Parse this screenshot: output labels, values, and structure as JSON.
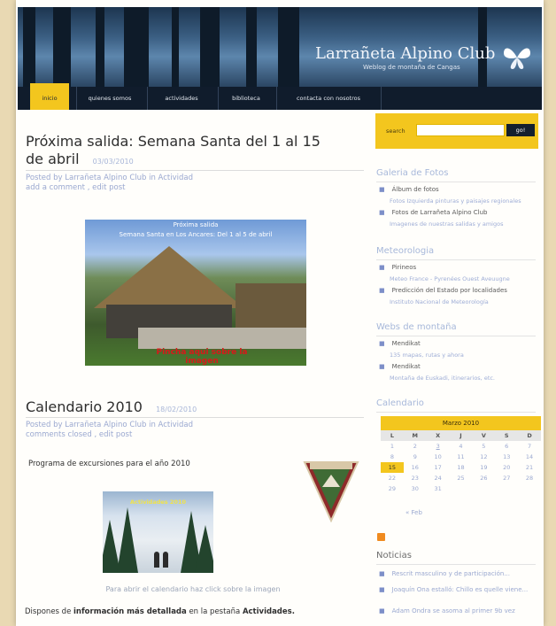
{
  "header": {
    "site_title": "Larrañeta Alpino Club",
    "site_subtitle": "Weblog de montaña de Cangas"
  },
  "nav": {
    "items": [
      {
        "label": "inicio",
        "active": true
      },
      {
        "label": "quienes somos"
      },
      {
        "label": "actividades"
      },
      {
        "label": "biblioteca"
      },
      {
        "label": "contacta con nosotros"
      }
    ]
  },
  "posts": [
    {
      "title_line1": "Próxima salida: Semana Santa del 1 al 15",
      "title_line2": "de abril",
      "date": "03/03/2010",
      "meta_line1": "Posted by Larrañeta Alpino Club in Actividad",
      "meta_line2": "add a comment , edit post",
      "image_caption_line1": "Próxima salida",
      "image_caption_line2": "Semana Santa en Los Ancares: Del 1 al 5 de abril",
      "image_red_text": "Pincha aqui sobre la imagen"
    },
    {
      "title": "Calendario 2010",
      "date": "18/02/2010",
      "meta_line1": "Posted by Larrañeta Alpino Club in Actividad",
      "meta_line2": "comments closed , edit post",
      "intro": "Programa de excursiones para el año 2010",
      "photo_caption": "Actividades 2010",
      "click_caption": "Para abrir el calendario haz click sobre la imagen",
      "bottom_plain": "Dispones de ",
      "bottom_bold": "información más detallada",
      "bottom_plain2": " en la  pestaña ",
      "bottom_bold2": "Actividades."
    }
  ],
  "sidebar": {
    "search_label": "search",
    "search_value": "",
    "search_button": "go!",
    "sections": [
      {
        "heading": "Galeria de Fotos",
        "items": [
          {
            "label": "Álbum de fotos",
            "sub": "Fotos Izquierda pinturas y paisajes regionales"
          },
          {
            "label": "Fotos de Larrañeta Alpino Club",
            "sub": "Imagenes de nuestras salidas y amigos"
          }
        ]
      },
      {
        "heading": "Meteorologia",
        "items": [
          {
            "label": "Pirineos",
            "sub": "Meteo France - Pyrenées Ouest Aveuugne"
          },
          {
            "label": "Predicción del Estado por localidades",
            "sub": "Instituto Nacional de Meteorología"
          }
        ]
      },
      {
        "heading": "Webs de montaña",
        "items": [
          {
            "label": "Mendikat",
            "sub": "135 mapas, rutas y ahora"
          },
          {
            "label": "Mendikat",
            "sub": "Montaña de Euskadi, itinerarios, etc."
          }
        ]
      }
    ],
    "calendar_heading": "Calendario",
    "calendar": {
      "month": "Marzo 2010",
      "day_headers": [
        "L",
        "M",
        "X",
        "J",
        "V",
        "S",
        "D"
      ],
      "days": [
        "1",
        "2",
        "3",
        "4",
        "5",
        "6",
        "7",
        "8",
        "9",
        "10",
        "11",
        "12",
        "13",
        "14",
        "15",
        "16",
        "17",
        "18",
        "19",
        "20",
        "21",
        "22",
        "23",
        "24",
        "25",
        "26",
        "27",
        "28",
        "29",
        "30",
        "31",
        "",
        "",
        "",
        ""
      ],
      "today": "15",
      "linked": [
        "3"
      ],
      "prev": "« Feb"
    },
    "news_heading": "Noticias",
    "news": [
      "Rescrit masculino y de participación...",
      "Joaquín Ona estalló: Chillo es quelle viene...",
      "Adam Ondra se asoma al primer 9b vez"
    ]
  }
}
